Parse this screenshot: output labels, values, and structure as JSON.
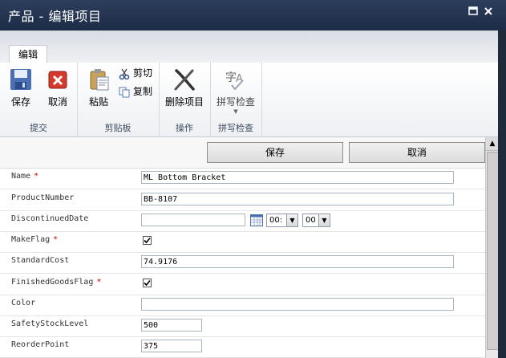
{
  "window": {
    "title": "产品 - 编辑项目"
  },
  "ribbon": {
    "tab_label": "编辑",
    "groups": {
      "submit": {
        "name": "提交",
        "save_label": "保存",
        "cancel_label": "取消"
      },
      "clipboard": {
        "name": "剪贴板",
        "paste_label": "粘贴",
        "cut_label": "剪切",
        "copy_label": "复制"
      },
      "actions": {
        "name": "操作",
        "delete_label": "删除项目"
      },
      "spelling": {
        "name": "拼写检查",
        "check_label": "拼写检查"
      }
    }
  },
  "form": {
    "save_button": "保存",
    "cancel_button": "取消",
    "fields": {
      "name": {
        "label": "Name",
        "required": "*",
        "value": "ML Bottom Bracket"
      },
      "product_number": {
        "label": "ProductNumber",
        "value": "BB-8107"
      },
      "discontinued_date": {
        "label": "DiscontinuedDate",
        "value": "",
        "hour": "00:",
        "minute": "00"
      },
      "make_flag": {
        "label": "MakeFlag",
        "required": "*",
        "checked": true
      },
      "standard_cost": {
        "label": "StandardCost",
        "value": "74.9176"
      },
      "finished_goods_flag": {
        "label": "FinishedGoodsFlag",
        "required": "*",
        "checked": true
      },
      "color": {
        "label": "Color",
        "value": ""
      },
      "safety_stock_level": {
        "label": "SafetyStockLevel",
        "value": "500"
      },
      "reorder_point": {
        "label": "ReorderPoint",
        "value": "375"
      }
    }
  }
}
